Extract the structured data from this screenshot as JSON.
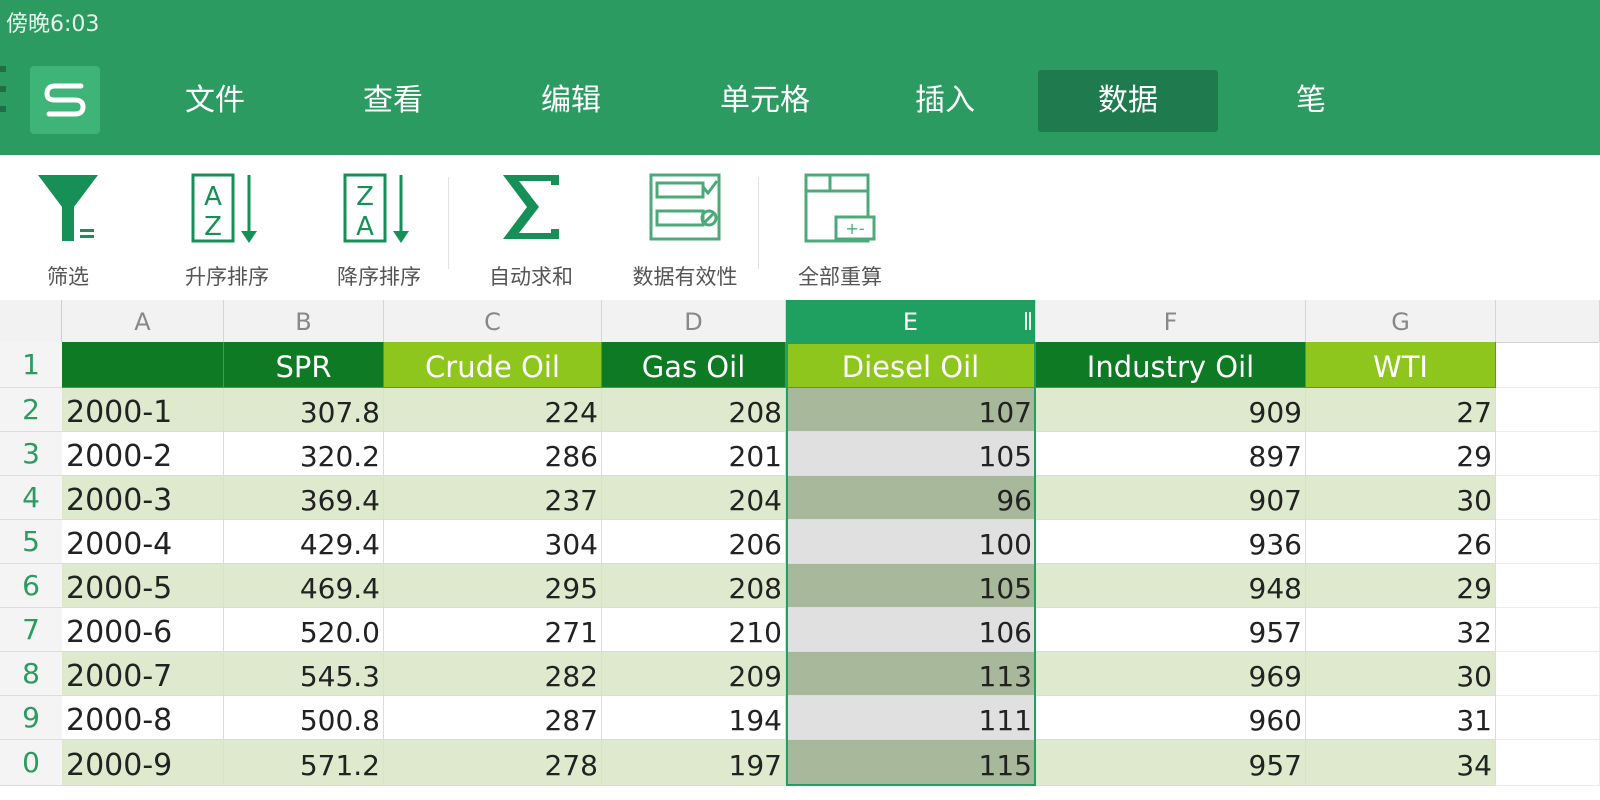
{
  "status_bar": {
    "time": "傍晚6:03"
  },
  "app": {
    "logo_icon": "wps-spreadsheet-s-logo"
  },
  "menu_tabs": [
    {
      "label": "文件",
      "active": false
    },
    {
      "label": "查看",
      "active": false
    },
    {
      "label": "编辑",
      "active": false
    },
    {
      "label": "单元格",
      "active": false
    },
    {
      "label": "插入",
      "active": false
    },
    {
      "label": "数据",
      "active": true
    },
    {
      "label": "笔",
      "active": false
    }
  ],
  "toolbar": {
    "filter": {
      "label": "筛选",
      "icon": "filter-funnel-icon"
    },
    "sort_asc": {
      "label": "升序排序",
      "icon": "sort-ascending-icon"
    },
    "sort_desc": {
      "label": "降序排序",
      "icon": "sort-descending-icon"
    },
    "autosum": {
      "label": "自动求和",
      "icon": "sigma-sum-icon"
    },
    "validation": {
      "label": "数据有效性",
      "icon": "data-validation-icon"
    },
    "recalc": {
      "label": "全部重算",
      "icon": "recalculate-all-icon"
    }
  },
  "sheet": {
    "columns": [
      "A",
      "B",
      "C",
      "D",
      "E",
      "F",
      "G"
    ],
    "selected_column": "E",
    "header_row": [
      "",
      "SPR",
      "Crude Oil",
      "Gas Oil",
      "Diesel Oil",
      "Industry Oil",
      "WTI"
    ],
    "rows": [
      {
        "num": "1"
      },
      {
        "num": "2",
        "cells": [
          "2000-1",
          "307.8",
          "224",
          "208",
          "107",
          "909",
          "27"
        ]
      },
      {
        "num": "3",
        "cells": [
          "2000-2",
          "320.2",
          "286",
          "201",
          "105",
          "897",
          "29"
        ]
      },
      {
        "num": "4",
        "cells": [
          "2000-3",
          "369.4",
          "237",
          "204",
          "96",
          "907",
          "30"
        ]
      },
      {
        "num": "5",
        "cells": [
          "2000-4",
          "429.4",
          "304",
          "206",
          "100",
          "936",
          "26"
        ]
      },
      {
        "num": "6",
        "cells": [
          "2000-5",
          "469.4",
          "295",
          "208",
          "105",
          "948",
          "29"
        ]
      },
      {
        "num": "7",
        "cells": [
          "2000-6",
          "520.0",
          "271",
          "210",
          "106",
          "957",
          "32"
        ]
      },
      {
        "num": "8",
        "cells": [
          "2000-7",
          "545.3",
          "282",
          "209",
          "113",
          "969",
          "30"
        ]
      },
      {
        "num": "9",
        "cells": [
          "2000-8",
          "500.8",
          "287",
          "194",
          "111",
          "960",
          "31"
        ]
      },
      {
        "num": "0",
        "cells": [
          "2000-9",
          "571.2",
          "278",
          "197",
          "115",
          "957",
          "34"
        ]
      }
    ]
  },
  "colors": {
    "app_bar": "#2c9b62",
    "header_dark_green": "#0e7a23",
    "header_light_green": "#8ec61e",
    "band_green": "#dfe9cd",
    "selected_band_dark": "#a8b89a",
    "selected_band_light": "#e0e0e0"
  }
}
